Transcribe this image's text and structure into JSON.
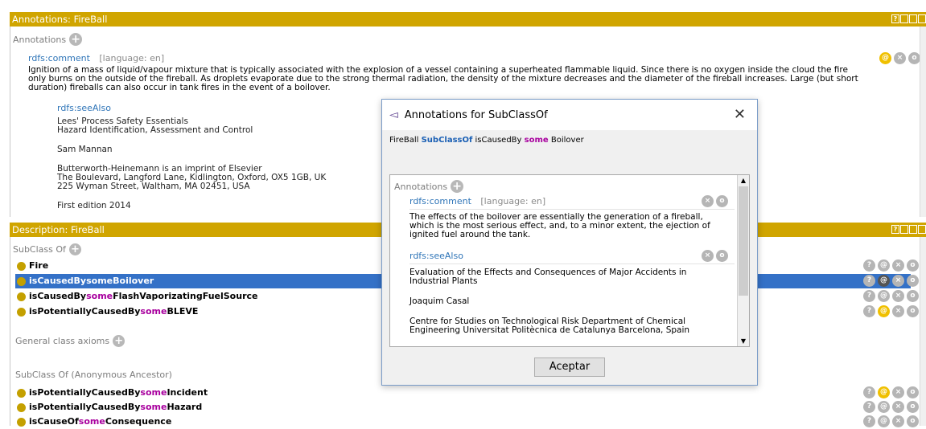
{
  "annotations_panel": {
    "header": "Annotations: FireBall",
    "section_title": "Annotations",
    "comment_label": "rdfs:comment",
    "comment_lang": "[language: en]",
    "comment_lines": [
      "Ignition of a mass of liquid/vapour mixture that is typically associated with the explosion of a vessel containing a superheated flammable liquid. Since there is no oxygen inside the cloud the fire",
      "only burns on the outside of the fireball. As droplets evaporate due to the strong thermal radiation, the density of the mixture decreases and the diameter of the fireball increases. Large (but short",
      "duration) fireballs can also occur in tank fires in the event of a boilover."
    ],
    "seealso_label": "rdfs:seeAlso",
    "seealso_lines": [
      "Lees' Process Safety Essentials",
      "Hazard Identification, Assessment and Control",
      "Sam Mannan",
      "Butterworth-Heinemann is an imprint of Elsevier",
      "The Boulevard, Langford Lane, Kidlington, Oxford, OX5 1GB, UK",
      "225 Wyman Street, Waltham, MA 02451, USA",
      "First edition 2014"
    ]
  },
  "description_panel": {
    "header": "Description: FireBall",
    "subclass_title": "SubClass Of",
    "subclass_rows": [
      {
        "pre": "Fire",
        "kw": "",
        "post": ""
      },
      {
        "pre": "isCausedBy ",
        "kw": "some",
        "post": " Boilover"
      },
      {
        "pre": "isCausedBy ",
        "kw": "some",
        "post": " FlashVaporizatingFuelSource"
      },
      {
        "pre": "isPotentiallyCausedBy ",
        "kw": "some",
        "post": " BLEVE"
      }
    ],
    "general_axioms_title": "General class axioms",
    "ancestor_title": "SubClass Of (Anonymous Ancestor)",
    "ancestor_rows": [
      {
        "pre": "isPotentiallyCausedBy ",
        "kw": "some",
        "post": " Incident"
      },
      {
        "pre": "isPotentiallyCausedBy ",
        "kw": "some",
        "post": " Hazard"
      },
      {
        "pre": "isCauseOf ",
        "kw": "some",
        "post": " Consequence"
      }
    ]
  },
  "dialog": {
    "title": "Annotations for SubClassOf",
    "axiom_subject": "FireBall",
    "axiom_rel": "SubClassOf",
    "axiom_prop": "isCausedBy",
    "axiom_kw": "some",
    "axiom_obj": "Boilover",
    "annotations_title": "Annotations",
    "comment_label": "rdfs:comment",
    "comment_lang": "[language: en]",
    "comment_lines": [
      "The effects of the boilover are essentially the generation of a fireball,",
      "which is the most serious effect, and, to a minor extent, the ejection of",
      "ignited fuel around the tank."
    ],
    "seealso_label": "rdfs:seeAlso",
    "seealso_lines": [
      "Evaluation of the Effects and Consequences of Major Accidents in",
      "Industrial Plants",
      "Joaquim Casal",
      "Centre for Studies on Technological Risk Department of Chemical",
      "Engineering Universitat Politècnica de Catalunya Barcelona, Spain"
    ],
    "ok_label": "Aceptar"
  },
  "icons": {
    "at": "@",
    "close": "×",
    "help": "?",
    "plus": "+"
  }
}
